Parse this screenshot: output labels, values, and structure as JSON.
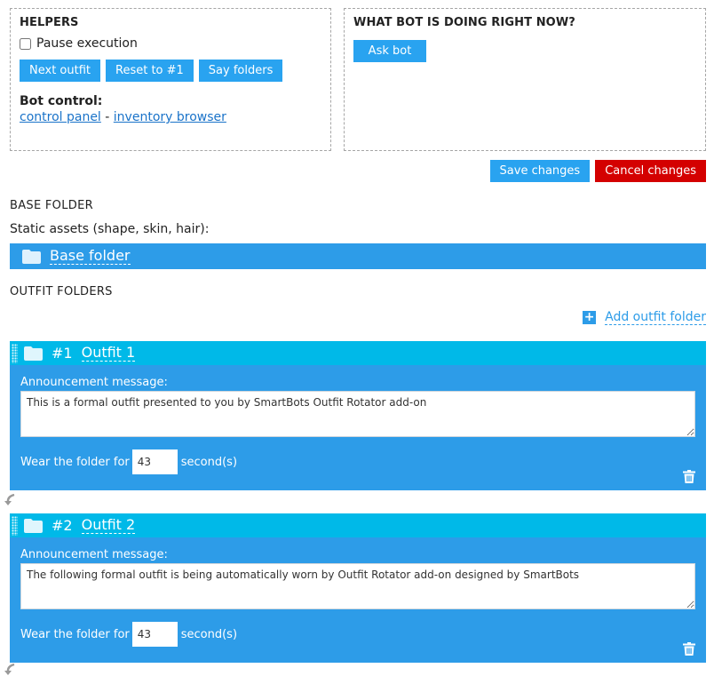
{
  "helpers": {
    "title": "HELPERS",
    "pause_label": "Pause execution",
    "buttons": [
      "Next outfit",
      "Reset to #1",
      "Say folders"
    ],
    "bot_control_title": "Bot control:",
    "link_control_panel": "control panel",
    "link_separator": "-",
    "link_inventory": "inventory browser"
  },
  "status": {
    "title": "WHAT BOT IS DOING RIGHT NOW?",
    "ask_label": "Ask bot"
  },
  "actions": {
    "save_label": "Save changes",
    "cancel_label": "Cancel changes"
  },
  "base": {
    "title": "BASE FOLDER",
    "subtitle": "Static assets (shape, skin, hair):",
    "folder_label": "Base folder"
  },
  "outfits": {
    "title": "OUTFIT FOLDERS",
    "add_label": "Add outfit folder",
    "items": [
      {
        "num": "#1",
        "name": "Outfit 1",
        "announce_label": "Announcement message:",
        "message": "This is a formal outfit presented to you by SmartBots Outfit Rotator add-on",
        "wear_prefix": "Wear the folder for",
        "seconds": "43",
        "wear_suffix": "second(s)"
      },
      {
        "num": "#2",
        "name": "Outfit 2",
        "announce_label": "Announcement message:",
        "message": "The following formal outfit is being automatically worn by Outfit Rotator add-on designed by SmartBots",
        "wear_prefix": "Wear the folder for",
        "seconds": "43",
        "wear_suffix": "second(s)"
      }
    ]
  },
  "colors": {
    "primary_blue": "#2d9ce8",
    "header_cyan": "#00b9e8",
    "cancel_red": "#d40000"
  }
}
